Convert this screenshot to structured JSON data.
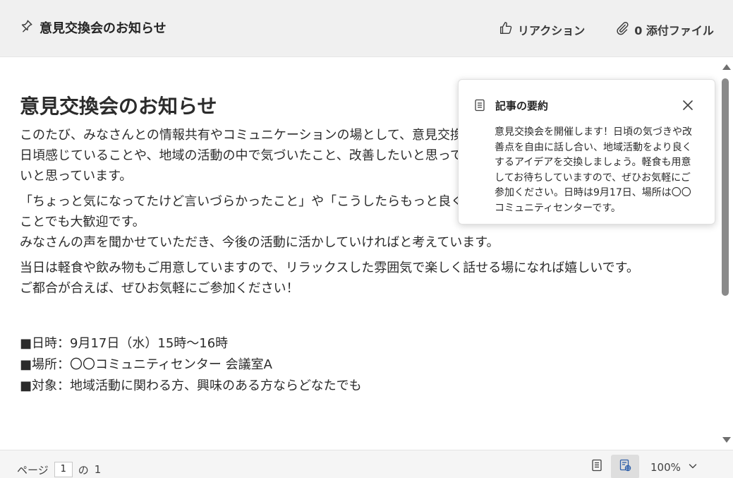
{
  "header": {
    "title": "意見交換会のお知らせ",
    "reaction_label": "リアクション",
    "attachments_label": "0 添付ファイル"
  },
  "document": {
    "title": "意見交換会のお知らせ",
    "paragraphs": [
      "このたび、みなさんとの情報共有やコミュニケーションの場として、意見交換会を開催することになりました。\n日頃感じていることや、地域の活動の中で気づいたこと、改善したいと思っていることなどを気軽に話し合える会にしたいと思っています。",
      "「ちょっと気になってたけど言いづらかったこと」や「こうしたらもっと良くなるかも！」というアイデアなど、どんなことでも大歓迎です。\nみなさんの声を聞かせていただき、今後の活動に活かしていければと考えています。",
      "当日は軽食や飲み物もご用意していますので、リラックスした雰囲気で楽しく話せる場になれば嬉しいです。\nご都合が合えば、ぜひお気軽にご参加ください！"
    ],
    "details": [
      "■日時：9月17日（水）15時〜16時",
      "■場所：〇〇コミュニティセンター 会議室A",
      "■対象：地域活動に関わる方、興味のある方ならどなたでも"
    ]
  },
  "summary": {
    "title": "記事の要約",
    "body": "意見交換会を開催します！日頃の気づきや改善点を自由に話し合い、地域活動をより良くするアイデアを交換しましょう。軽食も用意してお待ちしていますので、ぜひお気軽にご参加ください。日時は9月17日、場所は〇〇コミュニティセンターです。"
  },
  "footer": {
    "page_prefix": "ページ",
    "page_current": "1",
    "page_separator": "の",
    "page_total": "1",
    "zoom": "100%"
  },
  "colors": {
    "header_bg": "#f0f0f0",
    "page_bg": "#ffffff",
    "text": "#2b2b2b",
    "active_view_bg": "#dedede"
  }
}
